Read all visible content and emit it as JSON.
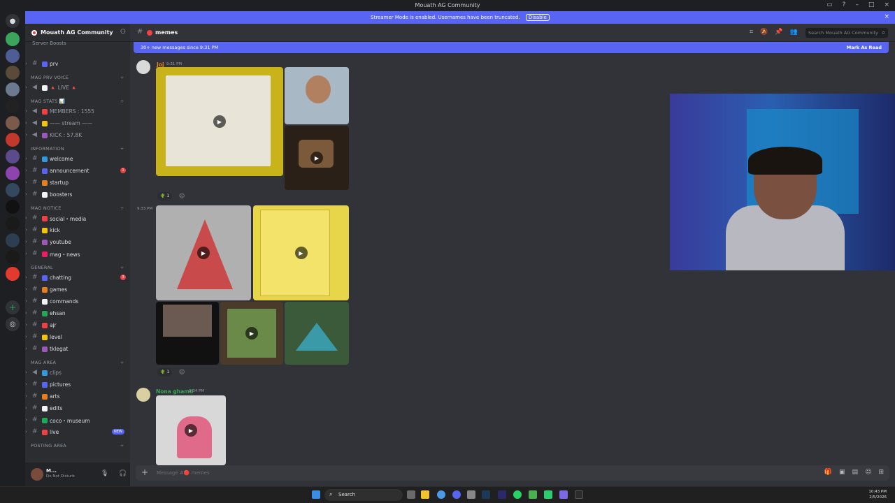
{
  "window": {
    "title": "Mouath AG Community"
  },
  "banner": {
    "text": "Streamer Mode is enabled. Usernames have been truncated.",
    "disable_label": "Disable"
  },
  "guild": {
    "name": "Mouath AG Community",
    "boosts_label": "Server Boosts"
  },
  "sidebar": {
    "items": [
      {
        "kind": "channel",
        "name": "prv"
      },
      {
        "kind": "category",
        "name": "MAG PRV VOICE"
      },
      {
        "kind": "channel",
        "name": "🔺 LIVE 🔺",
        "muted": true
      },
      {
        "kind": "category",
        "name": "MAG STATS 📊"
      },
      {
        "kind": "channel",
        "name": "MEMBERS : 1555",
        "muted": true
      },
      {
        "kind": "channel",
        "name": "—— stream ——",
        "muted": true
      },
      {
        "kind": "channel",
        "name": "KICK : 57.8K",
        "muted": true
      },
      {
        "kind": "category",
        "name": "INFORMATION"
      },
      {
        "kind": "channel",
        "name": "welcome"
      },
      {
        "kind": "channel",
        "name": "announcement",
        "badge": "1"
      },
      {
        "kind": "channel",
        "name": "startup"
      },
      {
        "kind": "channel",
        "name": "boosters"
      },
      {
        "kind": "category",
        "name": "MAG NOTICE"
      },
      {
        "kind": "channel",
        "name": "social・media"
      },
      {
        "kind": "channel",
        "name": "kick"
      },
      {
        "kind": "channel",
        "name": "youtube"
      },
      {
        "kind": "channel",
        "name": "mag・news"
      },
      {
        "kind": "category",
        "name": "GENERAL"
      },
      {
        "kind": "channel",
        "name": "chatting",
        "badge": "3"
      },
      {
        "kind": "channel",
        "name": "games"
      },
      {
        "kind": "channel",
        "name": "commands"
      },
      {
        "kind": "channel",
        "name": "ehsan"
      },
      {
        "kind": "channel",
        "name": "ajr"
      },
      {
        "kind": "channel",
        "name": "level"
      },
      {
        "kind": "channel",
        "name": "tklegat"
      },
      {
        "kind": "category",
        "name": "MAG AREA"
      },
      {
        "kind": "channel",
        "name": "clips",
        "muted": true
      },
      {
        "kind": "channel",
        "name": "pictures"
      },
      {
        "kind": "channel",
        "name": "arts"
      },
      {
        "kind": "channel",
        "name": "edits"
      },
      {
        "kind": "channel",
        "name": "coco・museum"
      },
      {
        "kind": "channel",
        "name": "live",
        "new": "NEW"
      },
      {
        "kind": "category",
        "name": "POSTING AREA"
      }
    ]
  },
  "user": {
    "name": "M...",
    "status": "Do Not Disturb"
  },
  "channel": {
    "name": "memes",
    "search_placeholder": "Search Mouath AG Community"
  },
  "newbar": {
    "text": "30+ new messages since 9:31 PM",
    "mark_label": "Mark As Read"
  },
  "messages": [
    {
      "author": "Joj",
      "time": "9:31 PM",
      "reaction_count": "1"
    },
    {
      "author": "",
      "time": "9:33 PM",
      "reaction_count": "1"
    },
    {
      "author": "Nona ghamd",
      "time": "9:34 PM"
    }
  ],
  "composer": {
    "placeholder": "Message #🔴 memes"
  },
  "taskbar": {
    "search_label": "Search",
    "time": "10:43 PM",
    "date": "2/5/2026"
  },
  "colors": {
    "accent": "#5865f2",
    "danger": "#f23f43",
    "online": "#23a55a"
  }
}
